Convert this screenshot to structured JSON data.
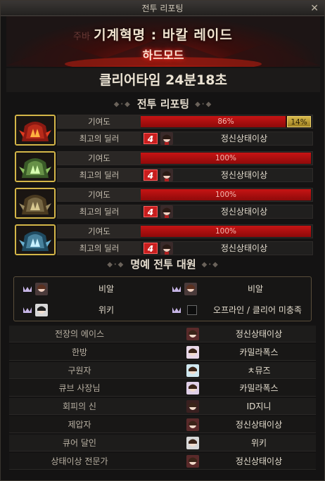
{
  "window": {
    "title": "전투 리포팅",
    "close_icon": "close-icon"
  },
  "banner": {
    "ghost_text": "주바",
    "raid_name": "기계혁명 : 바칼 레이드",
    "mode": "하드모드"
  },
  "clear": {
    "text": "클리어타임  24분18초"
  },
  "report": {
    "title": "전투 리포팅",
    "players": [
      {
        "portrait_icon": "red-mech-helmet-icon",
        "contribution_label": "기여도",
        "contribution_pct": "86%",
        "contribution_value": 0.86,
        "extra_pct": "14%",
        "dealer_label": "최고의 딜러",
        "dealer_rank": "4",
        "dealer_name": "정신상태이상"
      },
      {
        "portrait_icon": "green-mech-helmet-icon",
        "contribution_label": "기여도",
        "contribution_pct": "100%",
        "contribution_value": 1.0,
        "dealer_label": "최고의 딜러",
        "dealer_rank": "4",
        "dealer_name": "정신상태이상"
      },
      {
        "portrait_icon": "bronze-mech-helmet-icon",
        "contribution_label": "기여도",
        "contribution_pct": "100%",
        "contribution_value": 1.0,
        "dealer_label": "최고의 딜러",
        "dealer_rank": "4",
        "dealer_name": "정신상태이상"
      },
      {
        "portrait_icon": "blue-mech-helmet-icon",
        "contribution_label": "기여도",
        "contribution_pct": "100%",
        "contribution_value": 1.0,
        "dealer_label": "최고의 딜러",
        "dealer_rank": "4",
        "dealer_name": "정신상태이상"
      }
    ]
  },
  "honor": {
    "title": "명예 전투 대원",
    "entries": [
      {
        "name": "비알"
      },
      {
        "name": "비알"
      },
      {
        "name": "위키"
      },
      {
        "name": "오프라인 / 클리어 미충족"
      }
    ]
  },
  "awards": [
    {
      "title": "전장의 에이스",
      "winner": "정신상태이상"
    },
    {
      "title": "한방",
      "winner": "카밀라폭스"
    },
    {
      "title": "구원자",
      "winner": "ㅊ뮤즈"
    },
    {
      "title": "큐브 사장님",
      "winner": "카밀라폭스"
    },
    {
      "title": "회피의 신",
      "winner": "ID지니"
    },
    {
      "title": "제압자",
      "winner": "정신상태이상"
    },
    {
      "title": "큐어 달인",
      "winner": "위키"
    },
    {
      "title": "상태이상 전문가",
      "winner": "정신상태이상"
    }
  ],
  "colors": {
    "accent_red": "#c71414",
    "gold": "#d4b648"
  }
}
